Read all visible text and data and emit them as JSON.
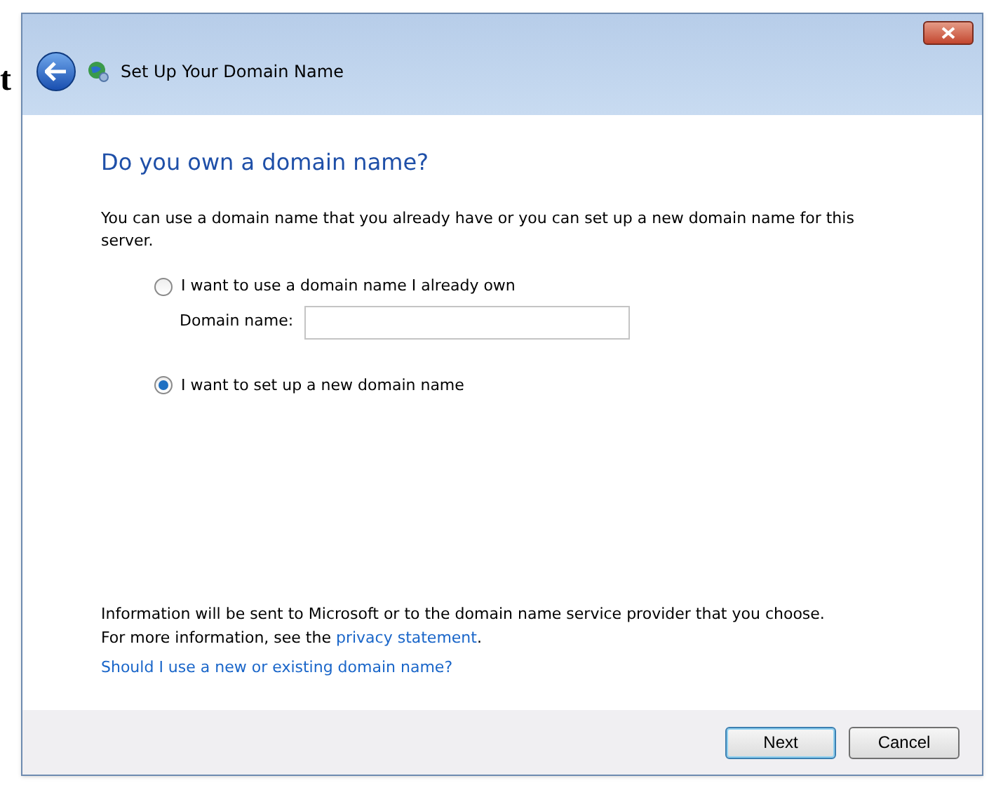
{
  "background_text": "t",
  "window": {
    "title": "Set Up Your Domain Name"
  },
  "heading": "Do you own a domain name?",
  "intro": "You can use a domain name that you already have or you can set up a new domain name for this server.",
  "options": [
    {
      "label": "I want to use a domain name I already own",
      "selected": false,
      "field": {
        "label": "Domain name:"
      }
    },
    {
      "label": "I want to set up a new domain name",
      "selected": true
    }
  ],
  "info": {
    "text_before": "Information will be sent to Microsoft or to the domain name service provider that you choose. For more information, see the ",
    "link": "privacy statement",
    "text_after": "."
  },
  "help_link": "Should I use a new or existing domain name?",
  "buttons": [
    {
      "label": "Next",
      "default": true
    },
    {
      "label": "Cancel",
      "default": false
    }
  ]
}
